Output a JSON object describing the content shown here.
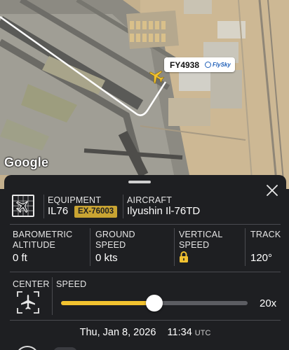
{
  "map": {
    "provider_logo": "Google",
    "flight_label": {
      "flight_number": "FY4938",
      "airline_logo_text": "FlySky"
    },
    "aircraft_icon": "plane-icon",
    "colors": {
      "track_line": "#ffffff",
      "aircraft": "#f2c230"
    }
  },
  "panel": {
    "equipment": {
      "label": "EQUIPMENT",
      "type_code": "IL76",
      "registration": "EX-76003",
      "icon": "aircraft-grid-icon"
    },
    "aircraft": {
      "label": "AIRCRAFT",
      "model": "Ilyushin Il-76TD"
    },
    "stats": [
      {
        "label_line1": "BAROMETRIC",
        "label_line2": "ALTITUDE",
        "value": "0 ft"
      },
      {
        "label_line1": "GROUND",
        "label_line2": "SPEED",
        "value": "0 kts"
      },
      {
        "label_line1": "VERTICAL",
        "label_line2": "SPEED",
        "value_icon": "lock-icon"
      },
      {
        "label_line1": "TRACK",
        "label_line2": "",
        "value": "120°"
      }
    ],
    "center": {
      "label": "CENTER",
      "icon": "center-aircraft-icon"
    },
    "speed": {
      "label": "SPEED",
      "value": "20x",
      "level": 0.5
    },
    "datetime": {
      "date": "Thu, Jan 8, 2026",
      "time": "11:34",
      "zone": "UTC"
    },
    "colors": {
      "accent": "#f2c230",
      "panel_bg": "#1e1f22",
      "badge_bg": "#c9a432"
    }
  }
}
